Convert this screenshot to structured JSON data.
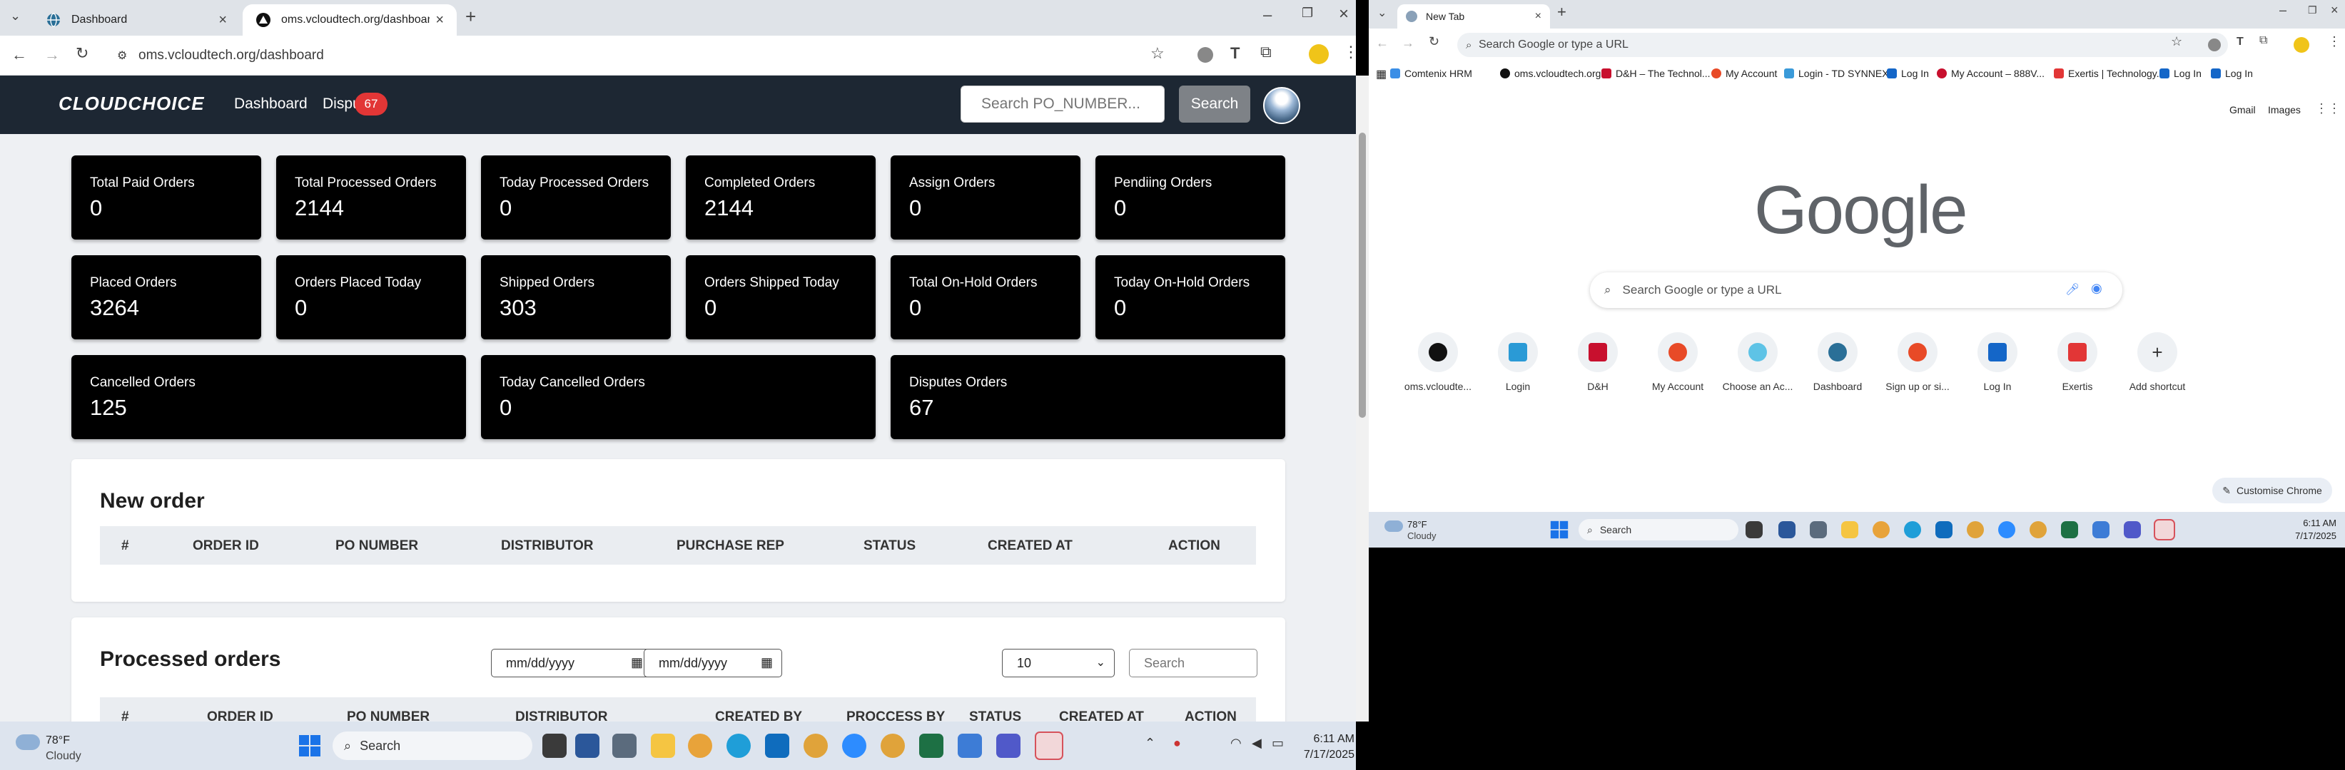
{
  "left_window": {
    "tabs": [
      {
        "title": "Dashboard",
        "active": false
      },
      {
        "title": "oms.vcloudtech.org/dashboard",
        "active": true
      }
    ],
    "url": "oms.vcloudtech.org/dashboard",
    "navbar": {
      "logo": "CLOUDCHOICE",
      "links": [
        "Dashboard",
        "Dispu"
      ],
      "disputes_badge": "67",
      "search_placeholder": "Search PO_NUMBER...",
      "search_button": "Search"
    },
    "stats_row1": [
      {
        "label": "Total Paid Orders",
        "value": "0"
      },
      {
        "label": "Total Processed Orders",
        "value": "2144"
      },
      {
        "label": "Today Processed Orders",
        "value": "0"
      },
      {
        "label": "Completed Orders",
        "value": "2144"
      },
      {
        "label": "Assign Orders",
        "value": "0"
      },
      {
        "label": "Pendiing Orders",
        "value": "0"
      }
    ],
    "stats_row2": [
      {
        "label": "Placed Orders",
        "value": "3264"
      },
      {
        "label": "Orders Placed Today",
        "value": "0"
      },
      {
        "label": "Shipped Orders",
        "value": "303"
      },
      {
        "label": "Orders Shipped Today",
        "value": "0"
      },
      {
        "label": "Total On-Hold Orders",
        "value": "0"
      },
      {
        "label": "Today On-Hold Orders",
        "value": "0"
      }
    ],
    "stats_row3": [
      {
        "label": "Cancelled Orders",
        "value": "125"
      },
      {
        "label": "Today Cancelled Orders",
        "value": "0"
      },
      {
        "label": "Disputes Orders",
        "value": "67"
      }
    ],
    "new_order": {
      "title": "New order",
      "columns": [
        "#",
        "ORDER ID",
        "PO NUMBER",
        "DISTRIBUTOR",
        "PURCHASE REP",
        "STATUS",
        "CREATED AT",
        "ACTION"
      ]
    },
    "processed_orders": {
      "title": "Processed orders",
      "date_from": "mm/dd/yyyy",
      "date_to": "mm/dd/yyyy",
      "page_size": "10",
      "search_placeholder": "Search",
      "columns": [
        "#",
        "ORDER ID",
        "PO NUMBER",
        "DISTRIBUTOR",
        "CREATED BY",
        "PROCCESS BY",
        "STATUS",
        "CREATED AT",
        "ACTION"
      ]
    },
    "taskbar": {
      "weather_temp": "78°F",
      "weather_desc": "Cloudy",
      "search": "Search",
      "time": "6:11 AM",
      "date": "7/17/2025"
    }
  },
  "right_window": {
    "tab_title": "New Tab",
    "url_placeholder": "Search Google or type a URL",
    "bookmarks": [
      "Comtenix HRM",
      "oms.vcloudtech.org",
      "D&H – The Technol...",
      "My Account",
      "Login - TD SYNNEX",
      "Log In",
      "My Account – 888V...",
      "Exertis | Technology...",
      "Log In",
      "Log In"
    ],
    "top_links": [
      "Gmail",
      "Images"
    ],
    "logo": "Google",
    "search_placeholder": "Search Google or type a URL",
    "shortcuts": [
      "oms.vcloudte...",
      "Login",
      "D&H",
      "My Account",
      "Choose an Ac...",
      "Dashboard",
      "Sign up or si...",
      "Log In",
      "Exertis",
      "Add shortcut"
    ],
    "customise": "Customise Chrome",
    "taskbar": {
      "weather_temp": "78°F",
      "weather_desc": "Cloudy",
      "search": "Search",
      "time": "6:11 AM",
      "date": "7/17/2025"
    }
  },
  "colors": {
    "navbar": "#1d2733",
    "card": "#000000",
    "badge": "#e23636",
    "search_btn": "#7e8287"
  }
}
